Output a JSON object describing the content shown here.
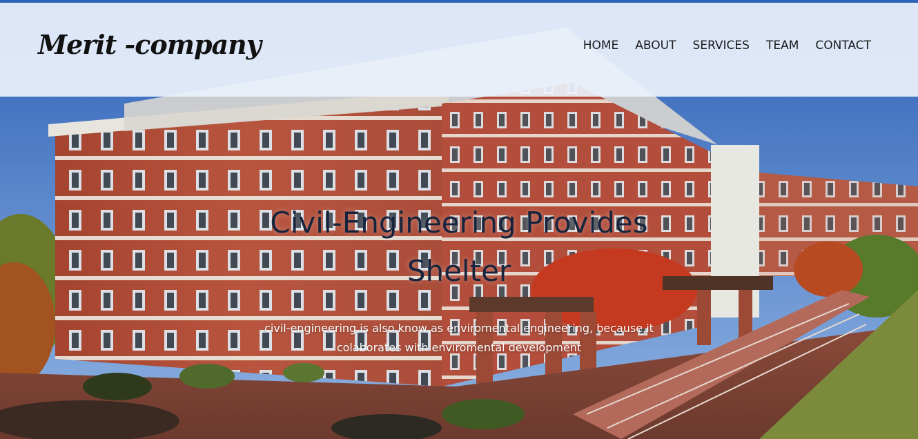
{
  "brand": {
    "logo_text": "Merit -company"
  },
  "nav": {
    "items": [
      {
        "label": "HOME"
      },
      {
        "label": "ABOUT"
      },
      {
        "label": "SERVICES"
      },
      {
        "label": "TEAM"
      },
      {
        "label": "CONTACT"
      }
    ]
  },
  "hero": {
    "title_line1": "Civil-Engineering Provides",
    "title_line2": "Shelter",
    "subtitle_line1": "civil-engineering is also know as enviromental engineering, because,it",
    "subtitle_line2": "colaborates with enviromental development",
    "background_image": "campus-brick-building-photo"
  },
  "colors": {
    "header_bg": "#ecf2fc",
    "title": "#17243d",
    "subtitle": "#ffffff",
    "nav_text": "#1b1b1b",
    "brick": "#b5523e",
    "sky": "#4d7bc4"
  }
}
